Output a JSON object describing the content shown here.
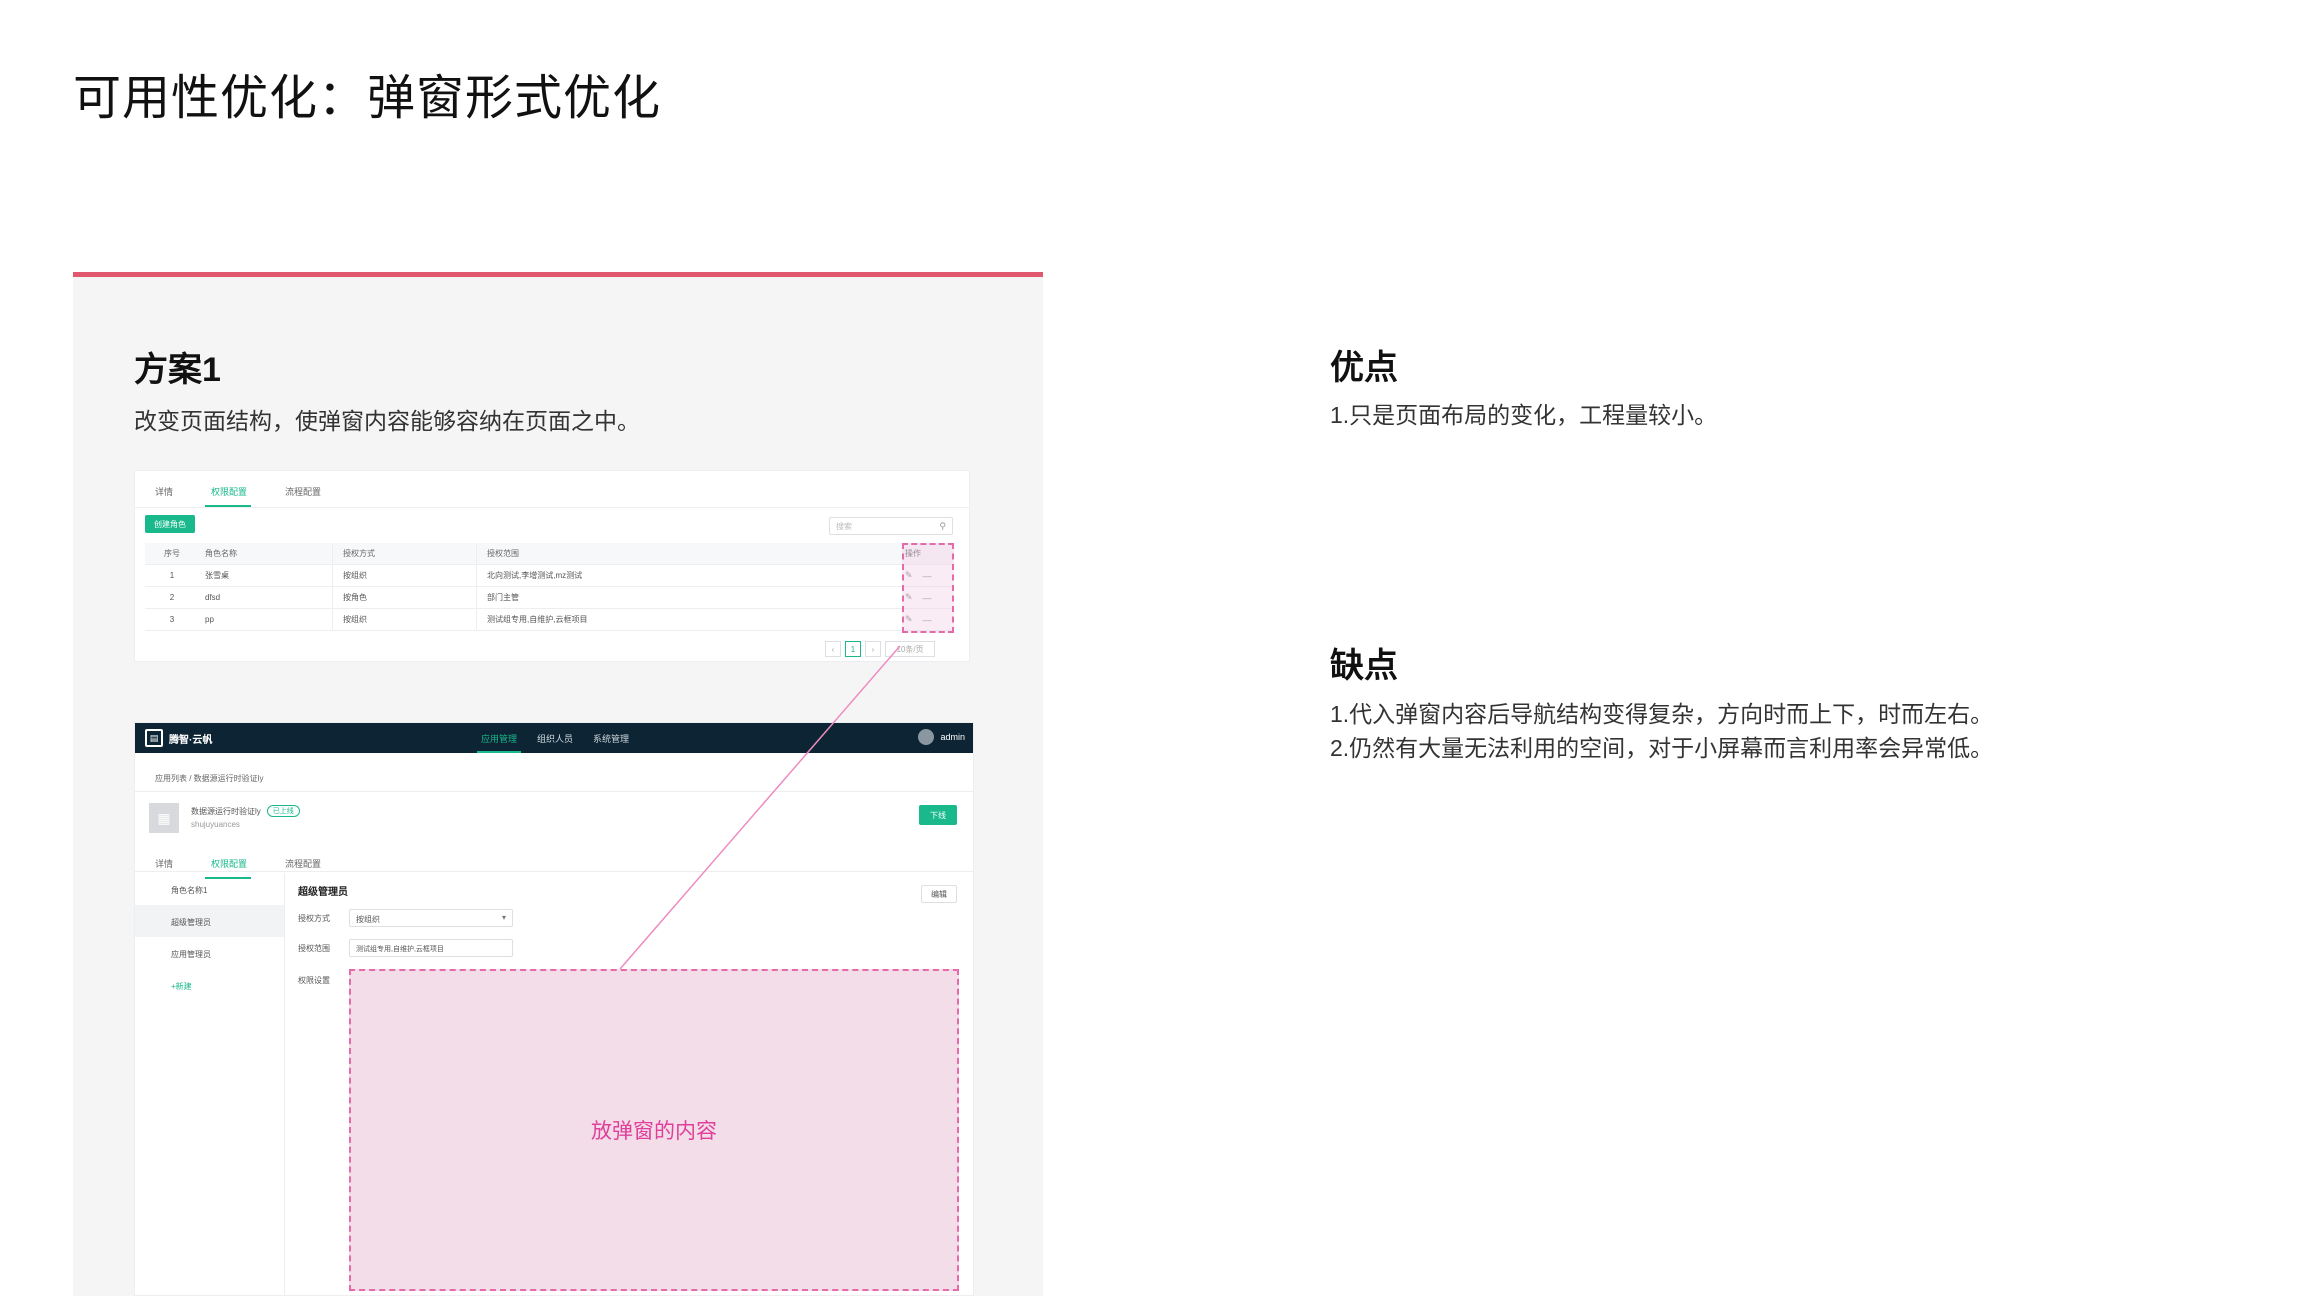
{
  "title": "可用性优化：弹窗形式优化",
  "panel": {
    "heading": "方案1",
    "desc": "改变页面结构，使弹窗内容能够容纳在页面之中。"
  },
  "shot_a": {
    "tabs": [
      "详情",
      "权限配置",
      "流程配置"
    ],
    "active_tab": 1,
    "create_button": "创建角色",
    "search_placeholder": "搜索",
    "table": {
      "headers": [
        "序号",
        "角色名称",
        "授权方式",
        "授权范围",
        "操作"
      ],
      "rows": [
        [
          "1",
          "张雪桌",
          "按组织",
          "北向测试,李增测试,mz测试"
        ],
        [
          "2",
          "dfsd",
          "按角色",
          "部门主管"
        ],
        [
          "3",
          "pp",
          "按组织",
          "测试组专用,自维护,云框项目"
        ]
      ]
    },
    "pager": {
      "current": "1",
      "size": "10条/页"
    }
  },
  "shot_b": {
    "logo": "腾智·云帆",
    "nav": [
      "应用管理",
      "组织人员",
      "系统管理"
    ],
    "active_nav": 0,
    "user": "admin",
    "breadcrumb": "应用列表 / 数据源运行时验证ly",
    "app_name": "数据源运行时验证ly",
    "app_status": "已上线",
    "app_code": "shujuyuances",
    "offline_button": "下线",
    "tabs": [
      "详情",
      "权限配置",
      "流程配置"
    ],
    "active_tab": 1,
    "sidebar": [
      "角色名称1",
      "超级管理员",
      "应用管理员",
      "+新建"
    ],
    "active_side": 1,
    "role_title": "超级管理员",
    "edit_button": "编辑",
    "form": {
      "auth_mode_label": "授权方式",
      "auth_mode_value": "按组织",
      "auth_scope_label": "授权范围",
      "auth_scope_value": "测试组专用,自维护,云框项目",
      "perm_label": "权限设置"
    },
    "popup_placeholder": "放弹窗的内容"
  },
  "pros": {
    "heading": "优点",
    "items": [
      "1.只是页面布局的变化，工程量较小。"
    ]
  },
  "cons": {
    "heading": "缺点",
    "items": [
      "1.代入弹窗内容后导航结构变得复杂，方向时而上下，时而左右。",
      "2.仍然有大量无法利用的空间，对于小屏幕而言利用率会异常低。"
    ]
  },
  "colors": {
    "accent": "#e0576e",
    "brand_green": "#19b98b",
    "highlight_pink": "#e56aa9",
    "nav_dark": "#0d2434"
  }
}
